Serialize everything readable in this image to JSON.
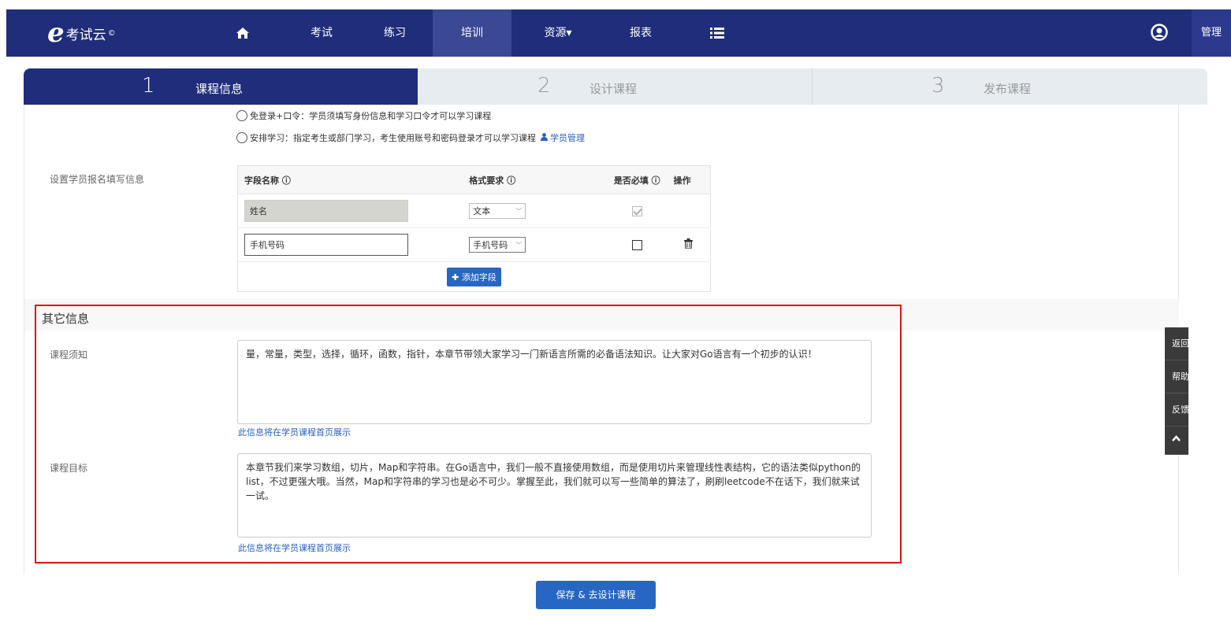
{
  "brand": {
    "letter": "e",
    "name": "考试云",
    "mark": "©"
  },
  "nav": {
    "items": [
      {
        "label": "考试"
      },
      {
        "label": "练习"
      },
      {
        "label": "培训"
      },
      {
        "label": "资源▾"
      },
      {
        "label": "报表"
      }
    ],
    "admin_label": "管理"
  },
  "steps": [
    {
      "num": "1",
      "label": "课程信息"
    },
    {
      "num": "2",
      "label": "设计课程"
    },
    {
      "num": "3",
      "label": "发布课程"
    }
  ],
  "access_options": {
    "option_password": "免登录+口令：学员须填写身份信息和学习口令才可以学习课程",
    "option_arrange": "安排学习：指定考生或部门学习，考生使用账号和密码登录才可以学习课程",
    "student_manage_link": "学员管理"
  },
  "signup": {
    "label": "设置学员报名填写信息",
    "headers": {
      "field": "字段名称 ⓘ",
      "format": "格式要求 ⓘ",
      "required": "是否必填 ⓘ",
      "action": "操作"
    },
    "rows": [
      {
        "field": "姓名",
        "format": "文本",
        "required": true,
        "locked": true
      },
      {
        "field": "手机号码",
        "format": "手机号码",
        "required": false,
        "locked": false
      }
    ],
    "add_button": "✚ 添加字段"
  },
  "other_info": {
    "title": "其它信息",
    "notice_label": "课程须知",
    "notice_text": "量，常量，类型，选择，循环，函数，指针，本章节带领大家学习一门新语言所需的必备语法知识。让大家对Go语言有一个初步的认识！",
    "notice_hint": "此信息将在学员课程首页展示",
    "goal_label": "课程目标",
    "goal_text": "本章节我们来学习数组，切片，Map和字符串。在Go语言中，我们一般不直接使用数组，而是使用切片来管理线性表结构，它的语法类似python的list，不过更强大哦。当然，Map和字符串的学习也是必不可少。掌握至此，我们就可以写一些简单的算法了，刷刷leetcode不在话下，我们就来试一试。",
    "goal_hint": "此信息将在学员课程首页展示"
  },
  "save_button": "保存 & 去设计课程",
  "side_tools": {
    "back": "返回",
    "help": "帮助",
    "feedback": "反馈"
  }
}
